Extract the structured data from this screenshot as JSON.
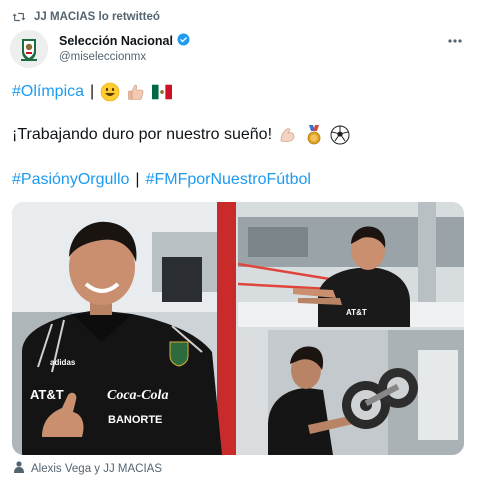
{
  "retweet": {
    "text": "JJ MACIAS lo retwitteó",
    "icon": "retweet-icon"
  },
  "author": {
    "name": "Selección Nacional",
    "handle": "@miseleccionmx",
    "verified_icon": "verified-badge-icon",
    "avatar": "fmf-crest-avatar",
    "more_icon": "more-options-icon"
  },
  "tweet": {
    "line1": {
      "hashtag": "#Olímpica",
      "separator": "|"
    },
    "line2": {
      "text": "¡Trabajando duro por nuestro sueño!"
    },
    "line3": {
      "hashtag1": "#PasiónyOrgullo",
      "separator": "|",
      "hashtag2": "#FMFporNuestroFútbol"
    }
  },
  "media": {
    "photo1": {
      "chest_text1": "AT&T",
      "chest_text2": "Coca-Cola",
      "chest_text3": "BANORTE",
      "brand": "adidas"
    },
    "photo2": {
      "chest_text": "AT&T"
    }
  },
  "tagged": {
    "icon": "person-icon",
    "text": "Alexis Vega y JJ MACIAS"
  },
  "colors": {
    "link": "#1d9bf0",
    "secondary_text": "#536471",
    "verified": "#1d9bf0"
  }
}
